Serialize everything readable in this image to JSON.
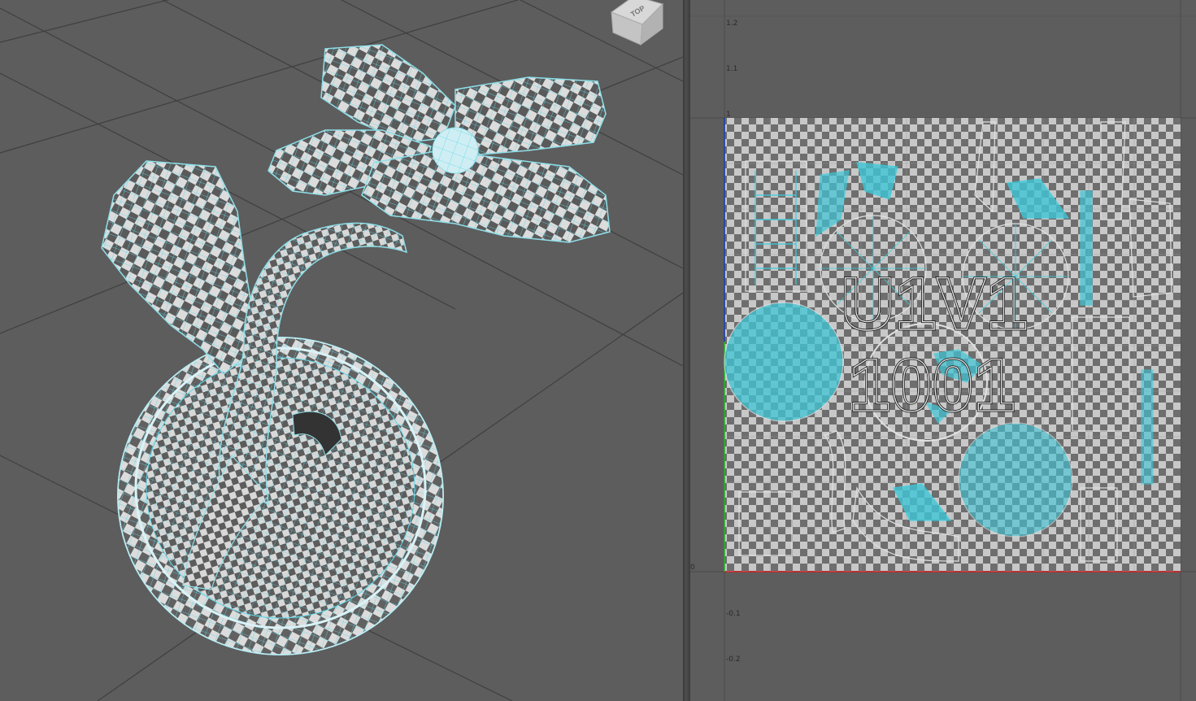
{
  "viewport3d": {
    "view_cube_label": "TOP",
    "wire_color": "#4fd6e6",
    "grid_color": "#3f3f3f",
    "background": "#5d5d5d"
  },
  "uv_editor": {
    "tile_label_row1": "U1V1",
    "tile_label_row2": "1001",
    "axis_ticks_v": [
      "1.2",
      "1.1",
      "1",
      "-0.1",
      "-0.2"
    ],
    "origin_tick": "0",
    "wire_color": "#33d0e0",
    "u_axis_color": "#d02020",
    "v_axis_color": "#20b020"
  }
}
